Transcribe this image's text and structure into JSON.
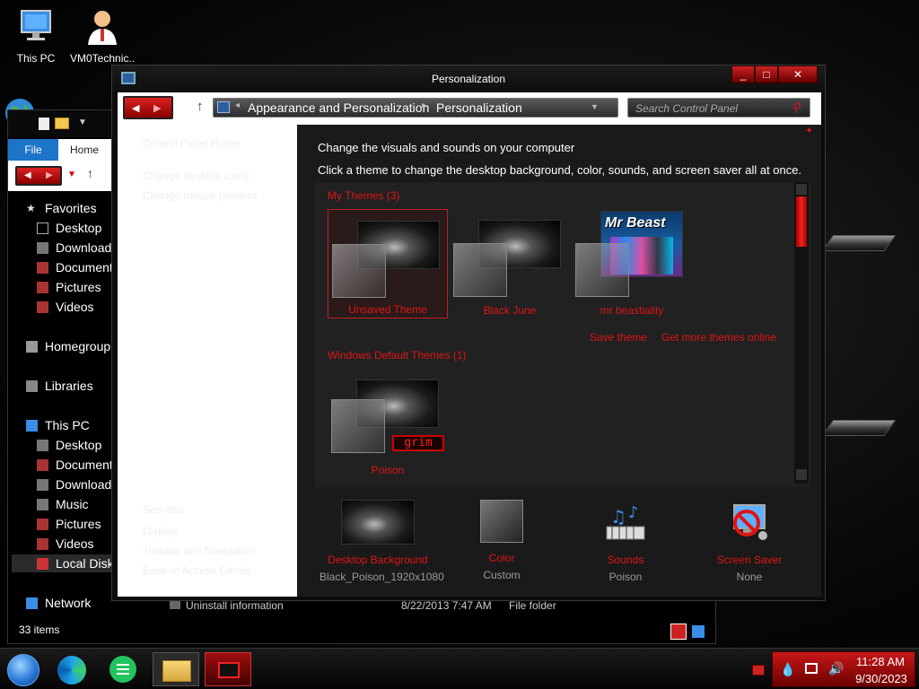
{
  "desktop": {
    "icons": [
      {
        "label": "This PC"
      },
      {
        "label": "VM0Technic..."
      }
    ]
  },
  "explorer": {
    "ribbon": {
      "file": "File",
      "home": "Home"
    },
    "tree": {
      "favorites": "Favorites",
      "desktop": "Desktop",
      "downloads": "Downloads",
      "documents": "Documents",
      "pictures": "Pictures",
      "videos": "Videos",
      "homegroup": "Homegroup",
      "libraries": "Libraries",
      "thispc": "This PC",
      "pc_desktop": "Desktop",
      "pc_documents": "Documents",
      "pc_downloads": "Downloads",
      "pc_music": "Music",
      "pc_pictures": "Pictures",
      "pc_videos": "Videos",
      "local_disk": "Local Disk (",
      "network": "Network"
    },
    "rows": [
      {
        "name": "Uninstall information",
        "date": "8/22/2013 7:47 AM",
        "type": "File folder"
      }
    ],
    "status": "33 items"
  },
  "pers": {
    "title": "Personalization",
    "controls": {
      "minimize": "_",
      "maximize": "□",
      "close": "✕"
    },
    "breadcrumb": {
      "part1": "Appearance and Personalization",
      "sep": "▸",
      "part2": "Personalization"
    },
    "search_placeholder": "Search Control Panel",
    "left": {
      "home": "Control Panel Home",
      "icons": "Change desktop icons",
      "pointers": "Change mouse pointers",
      "see_also": "See also",
      "display": "Display",
      "taskbar": "Taskbar and Navigation",
      "ease": "Ease of Access Center"
    },
    "heading": "Change the visuals and sounds on your computer",
    "subheading": "Click a theme to change the desktop background, color, sounds, and screen saver all at once.",
    "my_themes": "My Themes (3)",
    "themes": [
      {
        "name": "Unsaved Theme"
      },
      {
        "name": "Black June"
      },
      {
        "name": "mr beastiality",
        "art": "Mr Beast"
      }
    ],
    "links": {
      "save": "Save theme",
      "more": "Get more themes online"
    },
    "default_group": "Windows Default Themes (1)",
    "default_theme": {
      "name": "Poison",
      "badge": "grim"
    },
    "bottom": [
      {
        "name": "Desktop Background",
        "value": "Black_Poison_1920x1080"
      },
      {
        "name": "Color",
        "value": "Custom"
      },
      {
        "name": "Sounds",
        "value": "Poison"
      },
      {
        "name": "Screen Saver",
        "value": "None"
      }
    ]
  },
  "taskbar": {
    "time": "11:28 AM",
    "date": "9/30/2023"
  },
  "colors": {
    "accent": "#e01414",
    "bg": "#1a1a1a"
  }
}
